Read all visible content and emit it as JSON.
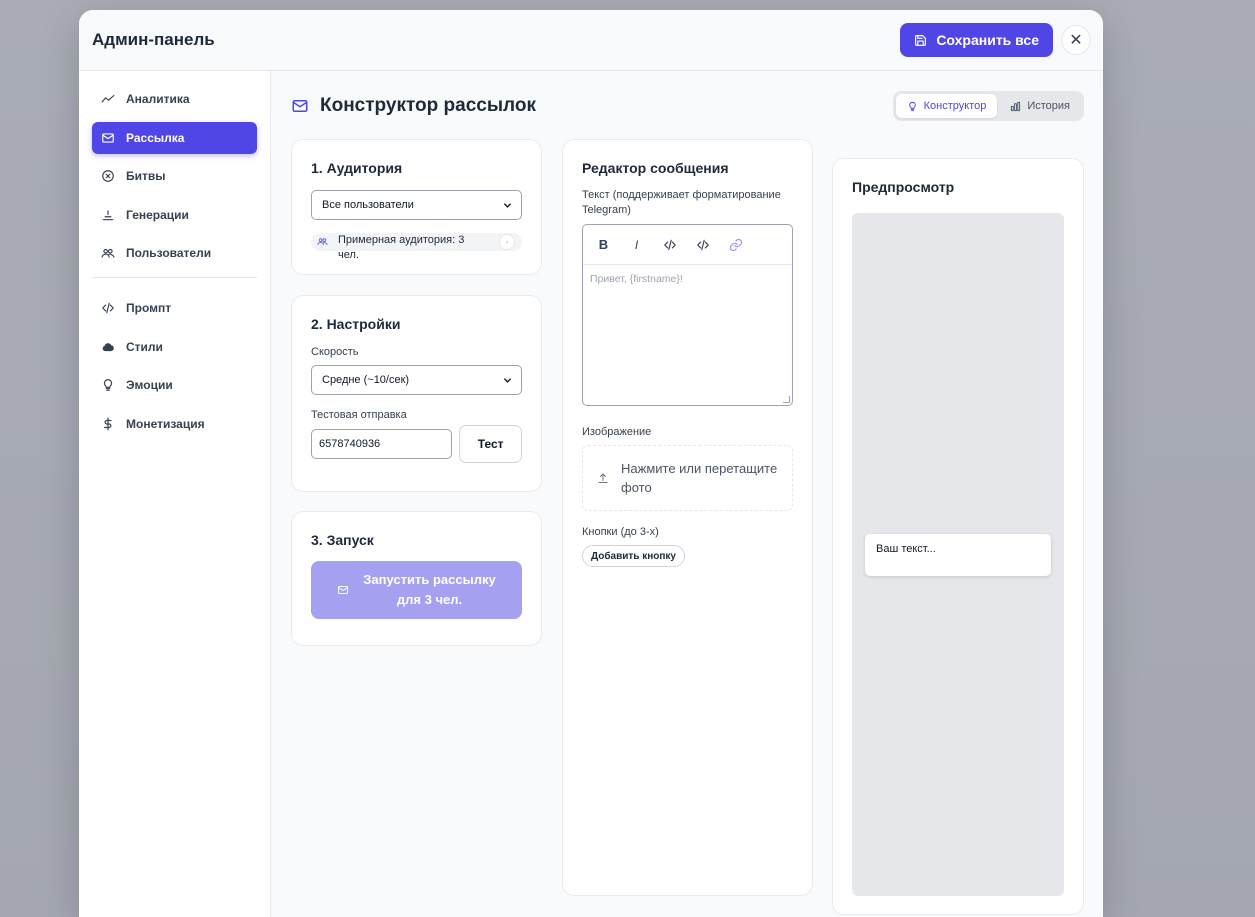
{
  "modal": {
    "title": "Админ-панель",
    "save_label": "Сохранить все",
    "close_glyph": "✕"
  },
  "sidebar": {
    "items": [
      {
        "label": "Аналитика",
        "icon": "analytics-icon",
        "active": false
      },
      {
        "label": "Рассылка",
        "icon": "mail-icon",
        "active": true
      },
      {
        "label": "Битвы",
        "icon": "battle-icon",
        "active": false
      },
      {
        "label": "Генерации",
        "icon": "generations-icon",
        "active": false
      },
      {
        "label": "Пользователи",
        "icon": "users-icon",
        "active": false
      },
      {
        "label": "Промпт",
        "icon": "code-icon",
        "active": false
      },
      {
        "label": "Стили",
        "icon": "cloud-icon",
        "active": false
      },
      {
        "label": "Эмоции",
        "icon": "lightbulb-icon",
        "active": false
      },
      {
        "label": "Монетизация",
        "icon": "dollar-icon",
        "active": false
      }
    ]
  },
  "main": {
    "title": "Конструктор рассылок",
    "tabs": [
      {
        "label": "Конструктор",
        "icon": "lightbulb-icon",
        "active": true
      },
      {
        "label": "История",
        "icon": "bar-chart-icon",
        "active": false
      }
    ]
  },
  "audience": {
    "title": "1. Аудитория",
    "selected": "Все пользователи",
    "hint": "Примерная аудитория: 3 чел."
  },
  "settings": {
    "title": "2. Настройки",
    "speed_label": "Скорость",
    "speed_selected": "Средне (~10/сек)",
    "test_label": "Тестовая отправка",
    "test_value": "6578740936",
    "test_button": "Тест"
  },
  "launch": {
    "title": "3. Запуск",
    "button_line1": "Запустить рассылку",
    "button_line2": "для 3 чел."
  },
  "editor": {
    "title": "Редактор сообщения",
    "text_label": "Текст (поддерживает форматирование Telegram)",
    "toolbar": {
      "bold": "B",
      "italic": "I"
    },
    "placeholder": "Привет, {firstname}!",
    "image_label": "Изображение",
    "dropzone_line1": "Нажмите или перетащите",
    "dropzone_line2": "фото",
    "buttons_label": "Кнопки (до 3-х)",
    "add_button": "Добавить кнопку"
  },
  "preview": {
    "title": "Предпросмотр",
    "bubble_text": "Ваш текст..."
  },
  "colors": {
    "accent": "#4f46e5",
    "accent_disabled": "#a5a0f0",
    "backdrop": "#a9acb5"
  }
}
